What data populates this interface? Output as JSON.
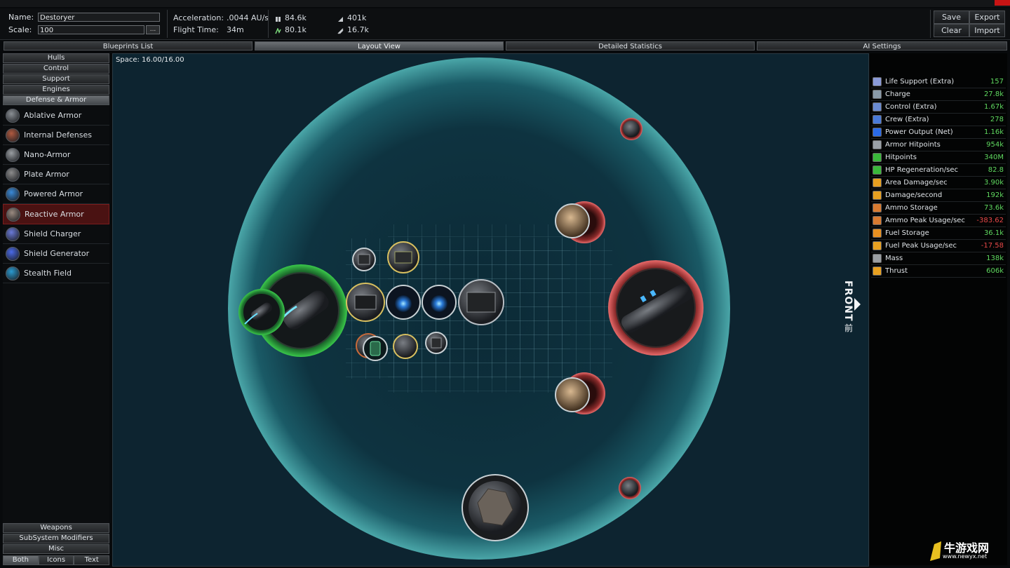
{
  "header": {
    "name_label": "Name:",
    "name_value": "Destoryer",
    "scale_label": "Scale:",
    "scale_value": "100",
    "browse_label": "...",
    "acceleration_label": "Acceleration:",
    "acceleration_value": ".0044 AU/s",
    "flight_time_label": "Flight Time:",
    "flight_time_value": "34m",
    "stat1": "84.6k",
    "stat2": "401k",
    "stat3": "80.1k",
    "stat4": "16.7k"
  },
  "toolbar": {
    "save": "Save",
    "export": "Export",
    "clear": "Clear",
    "import": "Import"
  },
  "tabs": [
    "Blueprints List",
    "Layout View",
    "Detailed Statistics",
    "AI Settings"
  ],
  "active_tab": "Layout View",
  "sidebar": {
    "categories": [
      "Hulls",
      "Control",
      "Support",
      "Engines",
      "Defense & Armor"
    ],
    "active_category": "Defense & Armor",
    "parts": [
      {
        "label": "Ablative Armor",
        "icon": "ablative-armor-icon",
        "color": "#8a8f94"
      },
      {
        "label": "Internal Defenses",
        "icon": "internal-defenses-icon",
        "color": "#b05a40"
      },
      {
        "label": "Nano-Armor",
        "icon": "nano-armor-icon",
        "color": "#9a9ea2"
      },
      {
        "label": "Plate Armor",
        "icon": "plate-armor-icon",
        "color": "#8c8c8c"
      },
      {
        "label": "Powered Armor",
        "icon": "powered-armor-icon",
        "color": "#3a8ad8"
      },
      {
        "label": "Reactive Armor",
        "icon": "reactive-armor-icon",
        "color": "#9a8a80"
      },
      {
        "label": "Shield Charger",
        "icon": "shield-charger-icon",
        "color": "#6a7ad8"
      },
      {
        "label": "Shield Generator",
        "icon": "shield-generator-icon",
        "color": "#4a6ae8"
      },
      {
        "label": "Stealth Field",
        "icon": "stealth-field-icon",
        "color": "#2a9ad0"
      }
    ],
    "active_part": "Reactive Armor",
    "bottom_categories": [
      "Weapons",
      "SubSystem Modifiers",
      "Misc"
    ],
    "view_modes": [
      "Both",
      "Icons",
      "Text"
    ],
    "active_view_mode": "Both"
  },
  "layout": {
    "space_label": "Space: 16.00/16.00",
    "front_label": "FRONT",
    "front_cn": "前"
  },
  "stats": [
    {
      "label": "Life Support (Extra)",
      "value": "157",
      "icon": "life-support-icon",
      "color": "#8a9ad8"
    },
    {
      "label": "Charge",
      "value": "27.8k",
      "icon": "charge-icon",
      "color": "#8a9aa8"
    },
    {
      "label": "Control (Extra)",
      "value": "1.67k",
      "icon": "control-icon",
      "color": "#6a8ad0"
    },
    {
      "label": "Crew (Extra)",
      "value": "278",
      "icon": "crew-icon",
      "color": "#4a7ad8"
    },
    {
      "label": "Power Output (Net)",
      "value": "1.16k",
      "icon": "power-icon",
      "color": "#2a6ae8"
    },
    {
      "label": "Armor Hitpoints",
      "value": "954k",
      "icon": "armor-icon",
      "color": "#9aa0a6"
    },
    {
      "label": "Hitpoints",
      "value": "340M",
      "icon": "hitpoints-icon",
      "color": "#3ab83a"
    },
    {
      "label": "HP Regeneration/sec",
      "value": "82.8",
      "icon": "hp-regen-icon",
      "color": "#3ab83a"
    },
    {
      "label": "Area Damage/sec",
      "value": "3.90k",
      "icon": "area-damage-icon",
      "color": "#e8a020"
    },
    {
      "label": "Damage/second",
      "value": "192k",
      "icon": "damage-icon",
      "color": "#e8a020"
    },
    {
      "label": "Ammo Storage",
      "value": "73.6k",
      "icon": "ammo-icon",
      "color": "#d87a30"
    },
    {
      "label": "Ammo Peak Usage/sec",
      "value": "-383.62",
      "icon": "ammo-usage-icon",
      "color": "#d87a30",
      "negative": true
    },
    {
      "label": "Fuel Storage",
      "value": "36.1k",
      "icon": "fuel-icon",
      "color": "#e89020"
    },
    {
      "label": "Fuel Peak Usage/sec",
      "value": "-17.58",
      "icon": "fuel-usage-icon",
      "color": "#e8a020",
      "negative": true
    },
    {
      "label": "Mass",
      "value": "138k",
      "icon": "mass-icon",
      "color": "#9a9ea2"
    },
    {
      "label": "Thrust",
      "value": "606k",
      "icon": "thrust-icon",
      "color": "#e8a020"
    }
  ],
  "watermark": {
    "brand": "牛游戏网",
    "url": "www.newyx.net"
  }
}
